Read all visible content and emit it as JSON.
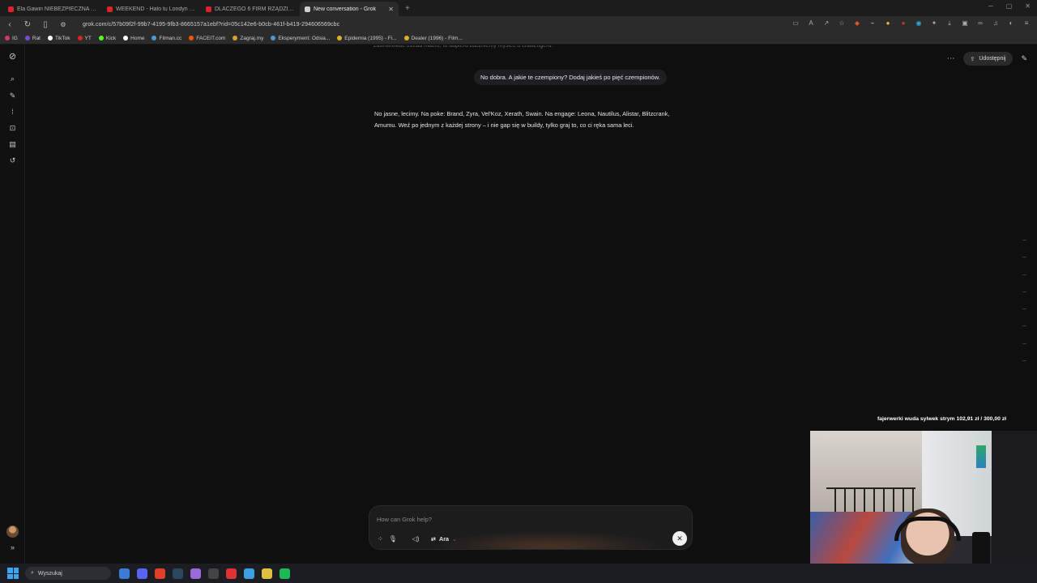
{
  "browser": {
    "tabs": [
      {
        "title": "Ela Gawin NIEBEZPIECZNA Youtub",
        "color": "#e0202a",
        "active": false
      },
      {
        "title": "WEEKEND - Halo tu Londyn (Oficjaln",
        "color": "#e0202a",
        "active": false
      },
      {
        "title": "DLACZEGO 6 FIRM RZĄDZI CAŁYM",
        "color": "#e0202a",
        "active": false
      },
      {
        "title": "New conversation - Grok",
        "color": "#d0d0d0",
        "active": true
      }
    ],
    "new_tab_icon": "plus-icon",
    "url": "grok.com/c/57b09f2f-99b7-4195-9fb3-8665157a1ebf?rid=05c142e6-b0cb-461f-b419-294606569cbc",
    "bookmarks": [
      {
        "label": "IG",
        "color": "#d6347a"
      },
      {
        "label": "Rat",
        "color": "#7a4bd6"
      },
      {
        "label": "TikTok",
        "color": "#ffffff"
      },
      {
        "label": "YT",
        "color": "#e0202a"
      },
      {
        "label": "Kick",
        "color": "#53fc18"
      },
      {
        "label": "Home",
        "color": "#ffffff"
      },
      {
        "label": "Filman.cc",
        "color": "#4a9ad6"
      },
      {
        "label": "FACEIT.com",
        "color": "#ff5500"
      },
      {
        "label": "Zagraj.my",
        "color": "#e0a030"
      },
      {
        "label": "Eksperyment: Odsia...",
        "color": "#4a9ad6"
      },
      {
        "label": "Epidemia (1995) - Fi...",
        "color": "#e0b020"
      },
      {
        "label": "Dealer (1996) - Film...",
        "color": "#e0b020"
      }
    ]
  },
  "sidebar": {
    "icons": [
      "grok-logo-icon",
      "search-icon",
      "edit-icon",
      "voice-icon",
      "image-icon",
      "folder-icon",
      "history-icon"
    ],
    "expand_icon": "chevron-right-icon"
  },
  "chat": {
    "faded_line": "zdominować trzeba macro, to dopiero zaczniemy myśleć o challengeru.",
    "user_message": "No dobra. A jakie te czempiony? Dodaj jakieś po pięć czempionów.",
    "assistant_message": "No jasne, lecimy. Na poke: Brand, Zyra, Vel'Koz, Xerath, Swain. Na engage: Leona, Nautilus, Alistar, Blitzcrank, Amumu. Weź po jednym z każdej strony – i nie gap się w buildy, tylko graj to, co ci ręka sama leci.",
    "share_label": "Udostępnij"
  },
  "composer": {
    "placeholder": "How can Grok help?",
    "value": "",
    "model": "Ara"
  },
  "stream_overlay": {
    "goal_text": "fajerwerki wuda sylwek strym  102,91 zł  /  300,00 zł"
  },
  "taskbar": {
    "search_label": "Wyszukaj",
    "apps": [
      {
        "name": "widgets",
        "color": "#3a7bd5"
      },
      {
        "name": "discord",
        "color": "#5865f2"
      },
      {
        "name": "chrome",
        "color": "#e0402a"
      },
      {
        "name": "steam",
        "color": "#2a475e"
      },
      {
        "name": "pen-tool",
        "color": "#9a6ad6"
      },
      {
        "name": "app-grid",
        "color": "#444"
      },
      {
        "name": "opera",
        "color": "#d33"
      },
      {
        "name": "paper-plane",
        "color": "#3aa0e0"
      },
      {
        "name": "lightbulb",
        "color": "#e0c040"
      },
      {
        "name": "spotify",
        "color": "#1db954"
      }
    ]
  }
}
